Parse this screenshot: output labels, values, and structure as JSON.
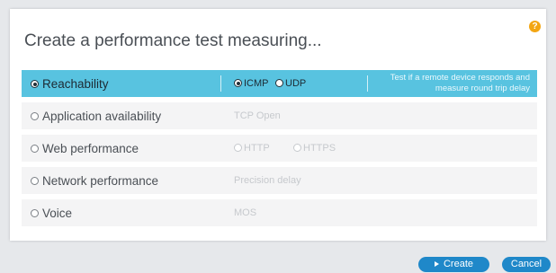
{
  "dialog": {
    "title": "Create a performance test measuring...",
    "help_icon": "?"
  },
  "options": [
    {
      "label": "Reachability",
      "selected": true,
      "protocols": [
        {
          "label": "ICMP",
          "checked": true
        },
        {
          "label": "UDP",
          "checked": false
        }
      ],
      "description": "Test if a remote device responds and measure round trip delay"
    },
    {
      "label": "Application availability",
      "selected": false,
      "detail": "TCP Open"
    },
    {
      "label": "Web performance",
      "selected": false,
      "protocols": [
        {
          "label": "HTTP",
          "checked": false
        },
        {
          "label": "HTTPS",
          "checked": false
        }
      ]
    },
    {
      "label": "Network performance",
      "selected": false,
      "detail": "Precision delay"
    },
    {
      "label": "Voice",
      "selected": false,
      "detail": "MOS"
    }
  ],
  "buttons": {
    "create": "Create",
    "cancel": "Cancel"
  },
  "colors": {
    "selected_row": "#58c3e0",
    "button": "#1f88c9",
    "help_icon": "#f3a613"
  }
}
